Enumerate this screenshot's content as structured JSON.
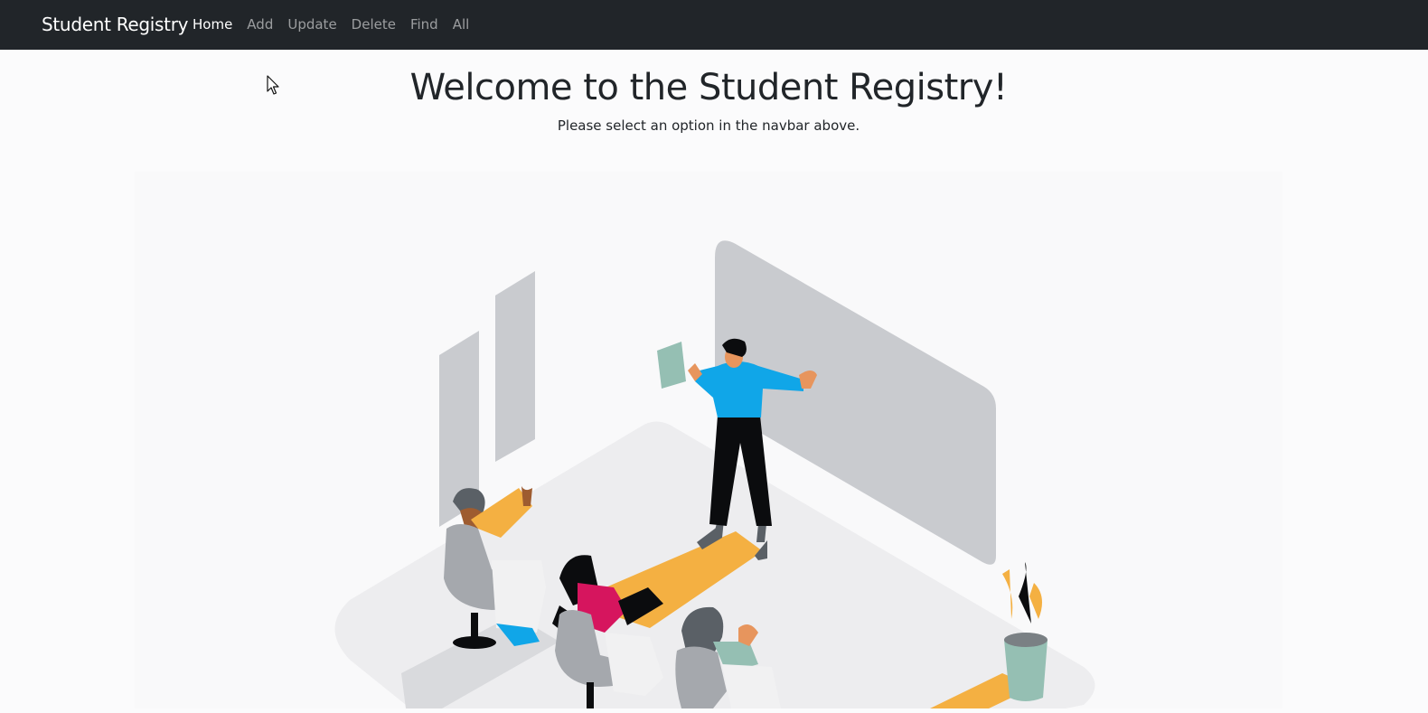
{
  "navbar": {
    "brand": "Student Registry",
    "links": [
      {
        "label": "Home",
        "active": true
      },
      {
        "label": "Add",
        "active": false
      },
      {
        "label": "Update",
        "active": false
      },
      {
        "label": "Delete",
        "active": false
      },
      {
        "label": "Find",
        "active": false
      },
      {
        "label": "All",
        "active": false
      }
    ]
  },
  "hero": {
    "title": "Welcome to the Student Registry!",
    "subtitle": "Please select an option in the navbar above."
  },
  "illustration": {
    "icon": "classroom-presentation-illustration"
  },
  "colors": {
    "navbar_bg": "#212529",
    "accent_yellow": "#f4b042",
    "accent_blue": "#10a6e8",
    "accent_pink": "#d6155e",
    "accent_sage": "#95bfb3",
    "panel_gray": "#c9cbcf"
  }
}
